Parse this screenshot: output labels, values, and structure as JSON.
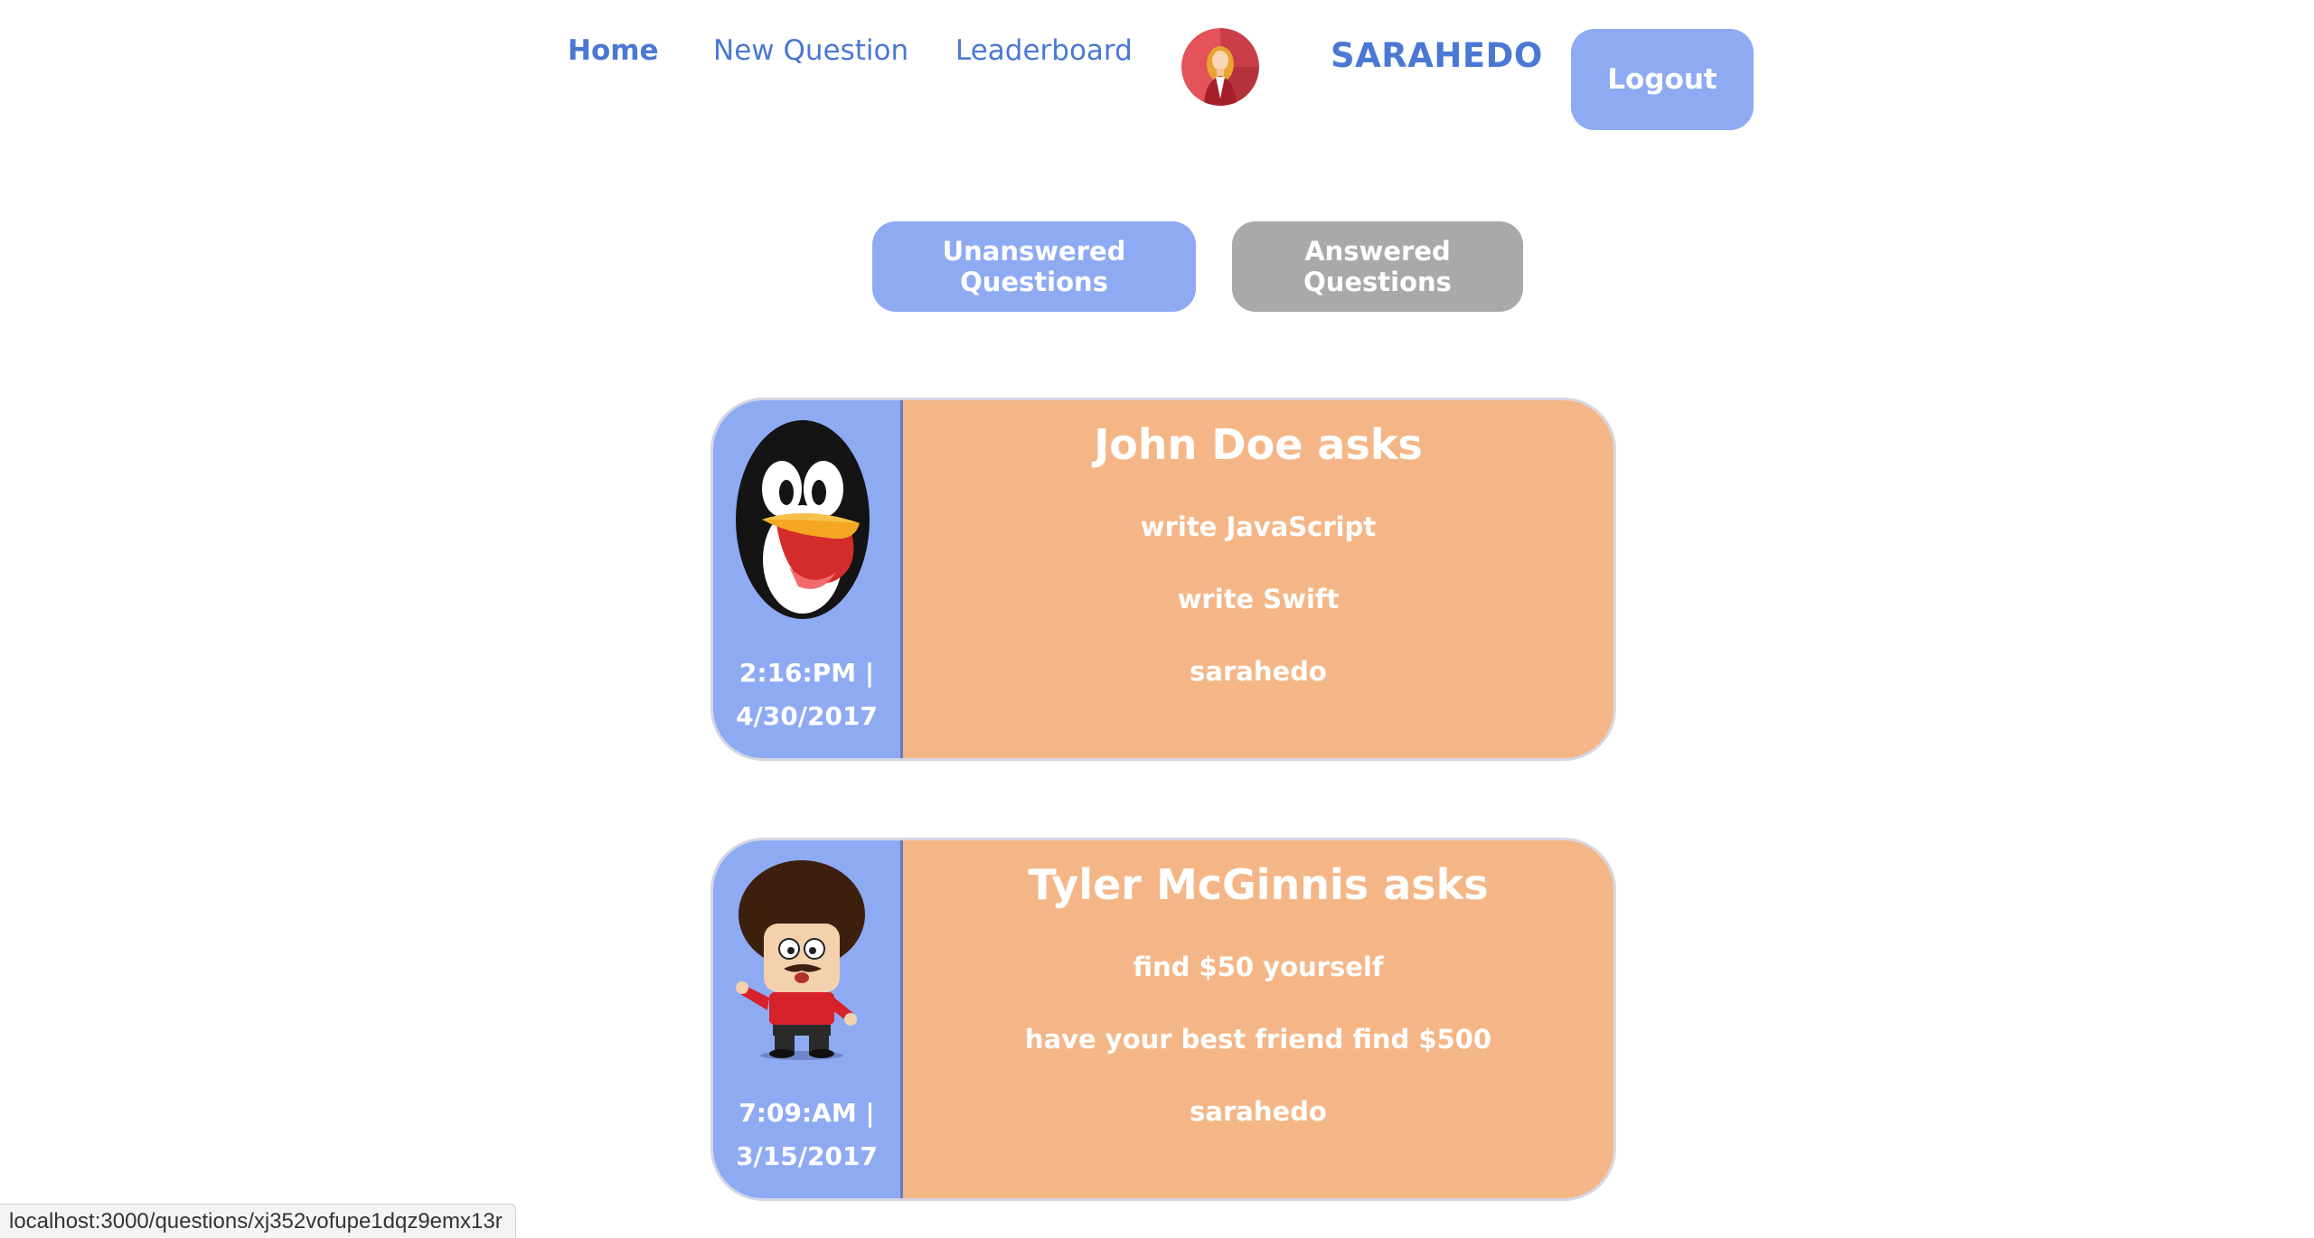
{
  "nav": {
    "home_label": "Home",
    "new_question_label": "New Question",
    "leaderboard_label": "Leaderboard",
    "avatar_icon": "woman-avatar-icon",
    "username": "SARAHEDO",
    "logout_label": "Logout"
  },
  "tabs": {
    "unanswered_label": "Unanswered Questions",
    "answered_label": "Answered Questions"
  },
  "questions": [
    {
      "heading": "John Doe asks",
      "avatar_icon": "penguin-avatar-icon",
      "time": "2:16:PM |",
      "date": "4/30/2017",
      "option_one": "write JavaScript",
      "option_two": "write Swift",
      "user": "sarahedo"
    },
    {
      "heading": "Tyler McGinnis asks",
      "avatar_icon": "cartoon-man-avatar-icon",
      "time": "7:09:AM |",
      "date": "3/15/2017",
      "option_one": "find $50 yourself",
      "option_two": "have your best friend find $500",
      "user": "sarahedo"
    }
  ],
  "status_bar": {
    "url": "localhost:3000/questions/xj352vofupe1dqz9emx13r"
  },
  "colors": {
    "accent_blue": "#8eaaf3",
    "link_blue": "#4a78d4",
    "card_orange": "#f5b687",
    "tab_inactive_gray": "#a9a9a9"
  }
}
